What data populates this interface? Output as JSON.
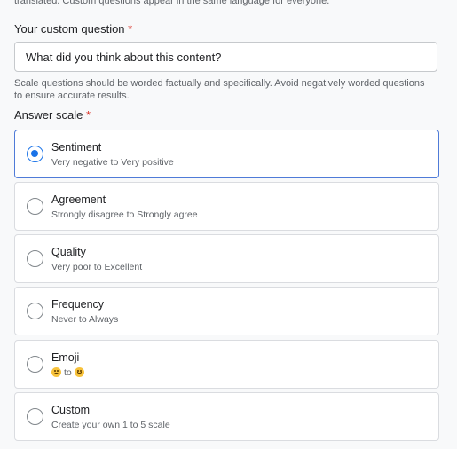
{
  "top_note": {
    "line1": "translated. Custom questions appear in the same language for everyone."
  },
  "question": {
    "label": "Your custom question",
    "required_mark": "*",
    "value": "What did you think about this content?",
    "hint": "Scale questions should be worded factually and specifically. Avoid negatively worded questions to ensure accurate results."
  },
  "answer_scale": {
    "label": "Answer scale",
    "required_mark": "*",
    "selected": "sentiment",
    "options": [
      {
        "title": "Sentiment",
        "subtitle": "Very negative to Very positive"
      },
      {
        "title": "Agreement",
        "subtitle": "Strongly disagree to Strongly agree"
      },
      {
        "title": "Quality",
        "subtitle": "Very poor to Excellent"
      },
      {
        "title": "Frequency",
        "subtitle": "Never to Always"
      },
      {
        "title": "Emoji",
        "subtitle_parts": {
          "from_icon": "weary-face-icon",
          "to": "to",
          "to_icon": "smiling-face-icon"
        }
      },
      {
        "title": "Custom",
        "subtitle": "Create your own 1 to 5 scale"
      }
    ]
  },
  "colors": {
    "accent": "#1a73e8",
    "required": "#d93025",
    "selected_border": "#4f7bd8"
  }
}
